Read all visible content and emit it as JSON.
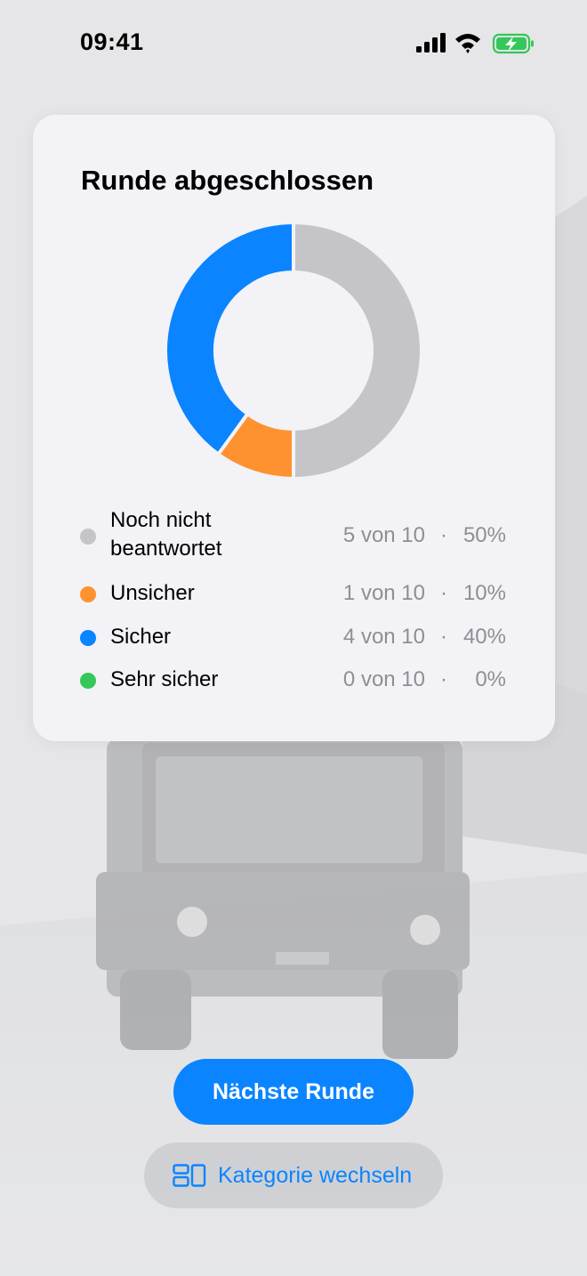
{
  "status_bar": {
    "time": "09:41",
    "icons": [
      "signal-icon",
      "wifi-icon",
      "battery-charging-icon"
    ]
  },
  "card": {
    "title": "Runde abgeschlossen"
  },
  "chart_data": {
    "type": "pie",
    "variant": "donut",
    "categories": [
      "Noch nicht beantwortet",
      "Unsicher",
      "Sicher",
      "Sehr sicher"
    ],
    "values": [
      5,
      1,
      4,
      0
    ],
    "total": 10,
    "colors": [
      "#c4c4c9",
      "#ff9230",
      "#0a84ff",
      "#34c759"
    ]
  },
  "legend": [
    {
      "label": "Noch nicht beantwortet",
      "count": "5 von 10",
      "sep": "·",
      "percent": "50%",
      "color": "#c4c4c9"
    },
    {
      "label": "Unsicher",
      "count": "1 von 10",
      "sep": "·",
      "percent": "10%",
      "color": "#ff9230"
    },
    {
      "label": "Sicher",
      "count": "4 von 10",
      "sep": "·",
      "percent": "40%",
      "color": "#0a84ff"
    },
    {
      "label": "Sehr sicher",
      "count": "0 von 10",
      "sep": "·",
      "percent": "0%",
      "color": "#34c759"
    }
  ],
  "actions": {
    "next_round_label": "Nächste Runde",
    "switch_category_label": "Kategorie wechseln",
    "switch_category_icon": "layout-grid-icon"
  },
  "colors": {
    "accent": "#0a84ff",
    "card_bg": "#f2f2f7",
    "secondary_text": "#8e8e93"
  }
}
